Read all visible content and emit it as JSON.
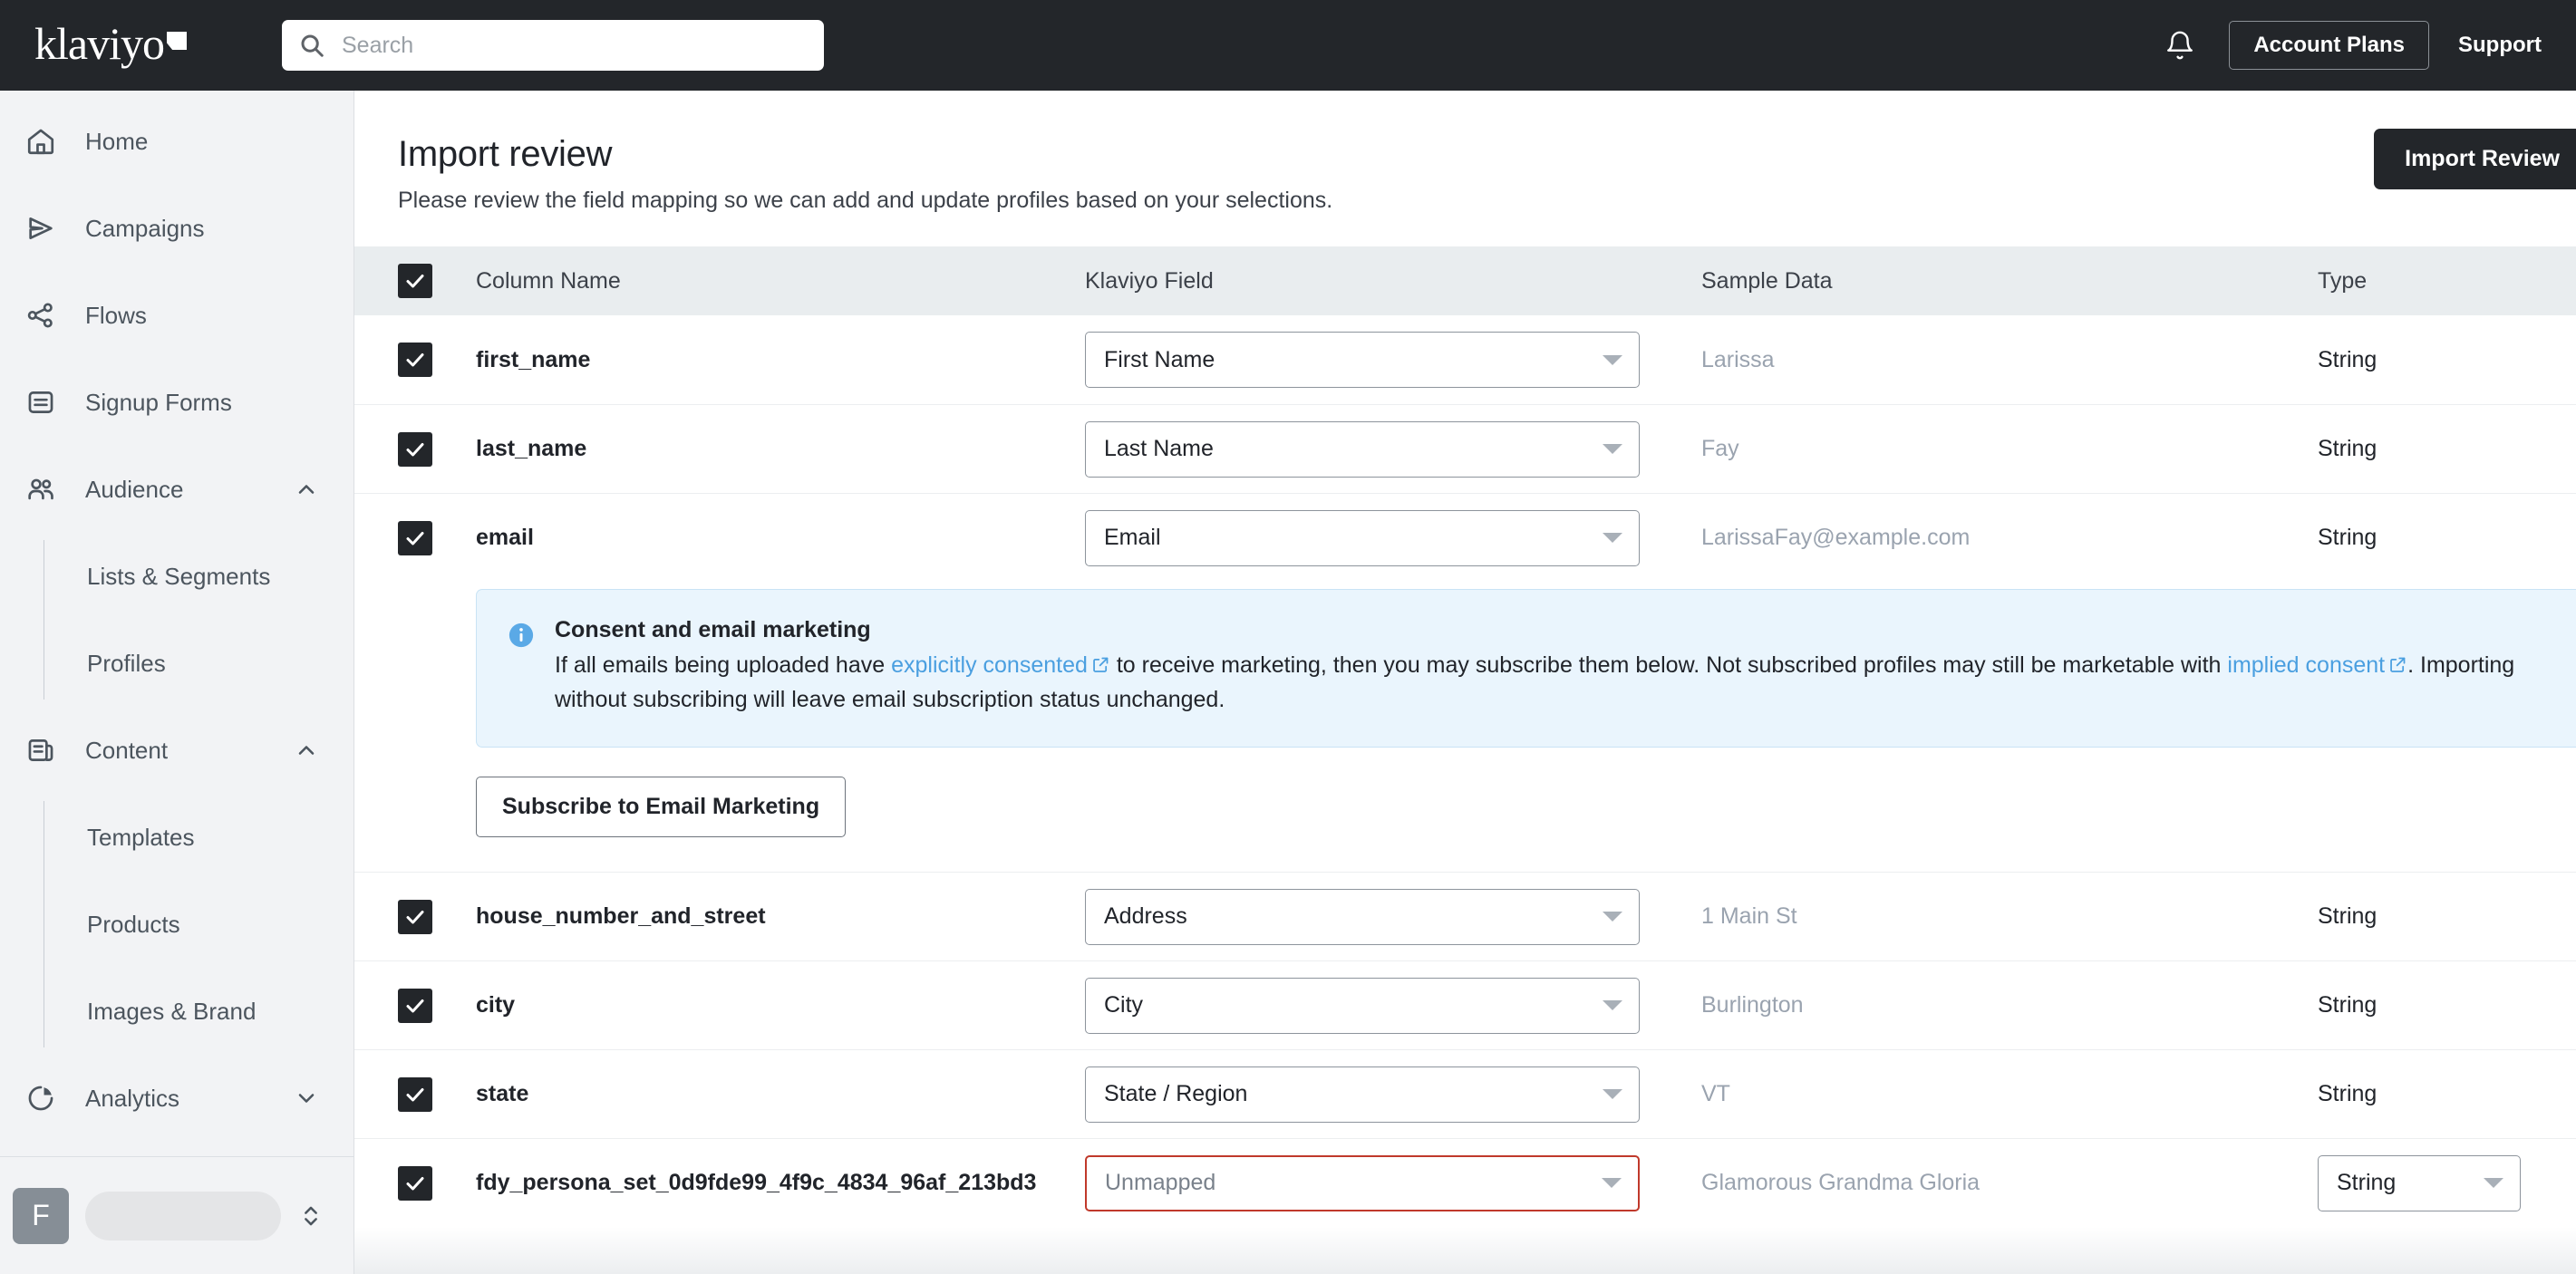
{
  "topbar": {
    "logo_text": "klaviyo",
    "search_placeholder": "Search",
    "search_value": "",
    "account_plans_label": "Account Plans",
    "support_label": "Support"
  },
  "sidebar": {
    "items": [
      {
        "label": "Home",
        "icon": "home-icon",
        "expandable": false
      },
      {
        "label": "Campaigns",
        "icon": "send-icon",
        "expandable": false
      },
      {
        "label": "Flows",
        "icon": "flows-icon",
        "expandable": false
      },
      {
        "label": "Signup Forms",
        "icon": "form-icon",
        "expandable": false
      },
      {
        "label": "Audience",
        "icon": "people-icon",
        "expandable": true,
        "state": "expanded",
        "children": [
          {
            "label": "Lists & Segments"
          },
          {
            "label": "Profiles"
          }
        ]
      },
      {
        "label": "Content",
        "icon": "content-icon",
        "expandable": true,
        "state": "expanded",
        "children": [
          {
            "label": "Templates"
          },
          {
            "label": "Products"
          },
          {
            "label": "Images & Brand"
          }
        ]
      },
      {
        "label": "Analytics",
        "icon": "pie-chart-icon",
        "expandable": true,
        "state": "collapsed"
      }
    ],
    "account": {
      "avatar_initial": "F",
      "name": ""
    }
  },
  "main": {
    "title": "Import review",
    "subtitle": "Please review the field mapping so we can add and update profiles based on your selections.",
    "primary_button": "Import Review",
    "table": {
      "headers": [
        "Column Name",
        "Klaviyo Field",
        "Sample Data",
        "Type"
      ],
      "header_checked": true,
      "rows": [
        {
          "checked": true,
          "column_name": "first_name",
          "klaviyo_field": "First Name",
          "sample_data": "Larissa",
          "type": "String",
          "type_is_select": false,
          "field_error": false
        },
        {
          "checked": true,
          "column_name": "last_name",
          "klaviyo_field": "Last Name",
          "sample_data": "Fay",
          "type": "String",
          "type_is_select": false,
          "field_error": false
        },
        {
          "checked": true,
          "column_name": "email",
          "klaviyo_field": "Email",
          "sample_data": "LarissaFay@example.com",
          "type": "String",
          "type_is_select": false,
          "field_error": false
        },
        {
          "checked": true,
          "column_name": "house_number_and_street",
          "klaviyo_field": "Address",
          "sample_data": "1 Main St",
          "type": "String",
          "type_is_select": false,
          "field_error": false
        },
        {
          "checked": true,
          "column_name": "city",
          "klaviyo_field": "City",
          "sample_data": "Burlington",
          "type": "String",
          "type_is_select": false,
          "field_error": false
        },
        {
          "checked": true,
          "column_name": "state",
          "klaviyo_field": "State / Region",
          "sample_data": "VT",
          "type": "String",
          "type_is_select": false,
          "field_error": false
        },
        {
          "checked": true,
          "column_name": "fdy_persona_set_0d9fde99_4f9c_4834_96af_213bd3",
          "klaviyo_field": "Unmapped",
          "sample_data": "Glamorous Grandma Gloria",
          "type": "String",
          "type_is_select": true,
          "field_error": true
        }
      ]
    },
    "consent_banner": {
      "icon": "info-icon",
      "title": "Consent and email marketing",
      "text_part_1": "If all emails being uploaded have ",
      "link_1": "explicitly consented",
      "text_part_2": " to receive marketing, then you may subscribe them below. Not subscribed profiles may still be marketable with ",
      "link_2": "implied consent",
      "text_part_3": ". Importing without subscribing will leave email subscription status unchanged."
    },
    "subscribe_button": "Subscribe to Email Marketing"
  },
  "colors": {
    "topbar_bg": "#23262a",
    "sidebar_bg": "#f2f3f5",
    "accent_link": "#4a9fe0",
    "banner_bg": "#eaf5fd",
    "error_border": "#c0392b",
    "table_header_bg": "#e9edef"
  }
}
